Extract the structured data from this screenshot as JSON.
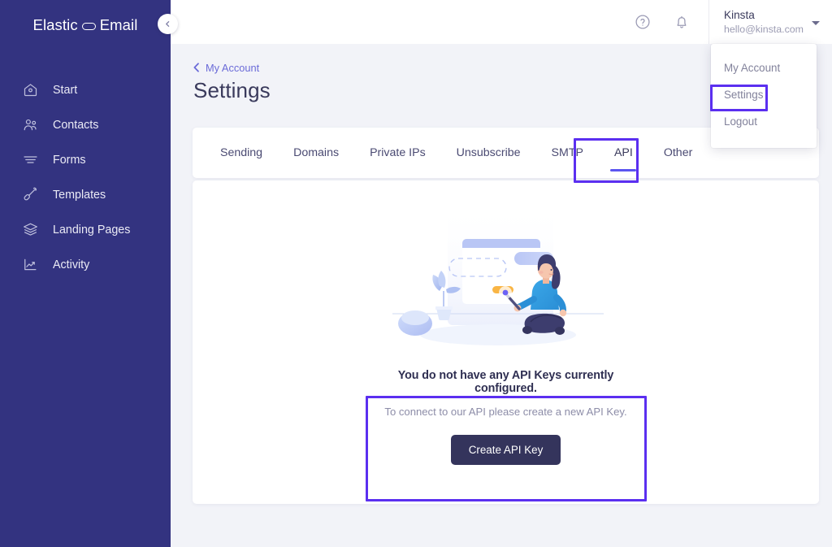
{
  "brand": {
    "logo_text_left": "Elastic",
    "logo_glyph": "link-oval-glyph",
    "logo_text_right": "Email",
    "sidebar_color": "#333380",
    "accent_color": "#5b55f0",
    "highlight_color": "#5b2ff0",
    "page_background": "#f2f3f8"
  },
  "sidebar": {
    "collapse_button_icon": "chevron-left-icon",
    "items": [
      {
        "label": "Start",
        "icon": "home-icon"
      },
      {
        "label": "Contacts",
        "icon": "people-icon"
      },
      {
        "label": "Forms",
        "icon": "form-lines-icon"
      },
      {
        "label": "Templates",
        "icon": "brush-icon"
      },
      {
        "label": "Landing Pages",
        "icon": "layers-icon"
      },
      {
        "label": "Activity",
        "icon": "chart-line-icon"
      }
    ]
  },
  "topbar": {
    "help_icon": "question-circle-icon",
    "notification_icon": "bell-icon",
    "user": {
      "name": "Kinsta",
      "email": "hello@kinsta.com",
      "caret_icon": "caret-down-icon"
    }
  },
  "user_menu": {
    "items": [
      {
        "label": "My Account",
        "highlighted": false
      },
      {
        "label": "Settings",
        "highlighted": true
      },
      {
        "label": "Logout",
        "highlighted": false
      }
    ]
  },
  "breadcrumb": {
    "back_icon": "chevron-left-icon",
    "label": "My Account"
  },
  "page": {
    "title": "Settings"
  },
  "tabs": {
    "items": [
      {
        "label": "Sending",
        "active": false
      },
      {
        "label": "Domains",
        "active": false
      },
      {
        "label": "Private IPs",
        "active": false
      },
      {
        "label": "Unsubscribe",
        "active": false
      },
      {
        "label": "SMTP",
        "active": false
      },
      {
        "label": "API",
        "active": true
      },
      {
        "label": "Other",
        "active": false
      }
    ]
  },
  "empty_state": {
    "illustration": "person-with-wand-and-card-illustration",
    "title": "You do not have any API Keys currently configured.",
    "subtitle": "To connect to our API please create a new API Key.",
    "button_label": "Create API Key"
  }
}
